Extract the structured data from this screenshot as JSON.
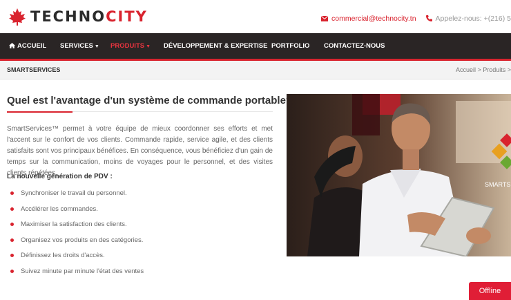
{
  "header": {
    "logo_text_dark": "TECHNO",
    "logo_text_red": "CITY",
    "email": "commercial@technocity.tn",
    "phone": "Appelez-nous: +(216) 5"
  },
  "nav": {
    "items": [
      {
        "label": "ACCUEIL",
        "icon": "home-icon"
      },
      {
        "label": "SERVICES",
        "icon": "caret-down-icon"
      },
      {
        "label": "PRODUITS",
        "icon": "caret-down-icon",
        "active": true
      },
      {
        "label": "DÉVELOPPEMENT & EXPERTISE"
      },
      {
        "label": "PORTFOLIO"
      },
      {
        "label": "CONTACTEZ-NOUS"
      }
    ]
  },
  "subheader": {
    "title": "SMARTSERVICES",
    "breadcrumb": "Accueil > Produits >"
  },
  "main": {
    "heading": "Quel est l'avantage d'un système de commande portable?",
    "intro": "SmartServices™ permet à votre équipe de mieux coordonner ses efforts et met l'accent sur le confort de vos clients. Commande rapide, service agile, et des clients satisfaits sont vos principaux bénéfices. En conséquence, vous bénéficiez d'un gain de temps sur la communication, moins de voyages pour le personnel, et des visites clients répétées.",
    "subheading": "La nouvelle génération de PDV :",
    "bullets": [
      "Synchroniser le travail du personnel.",
      "Accélérer les commandes.",
      "Maximiser la satisfaction des clients.",
      "Organisez vos produits en des catégories.",
      "Définissez les droits d'accès.",
      "Suivez minute par minute l'état des ventes"
    ],
    "photo_caption": "SMARTS"
  },
  "chat": {
    "status": "Offline"
  },
  "colors": {
    "brand_red": "#d9232e",
    "nav_bg": "#2a2525"
  }
}
